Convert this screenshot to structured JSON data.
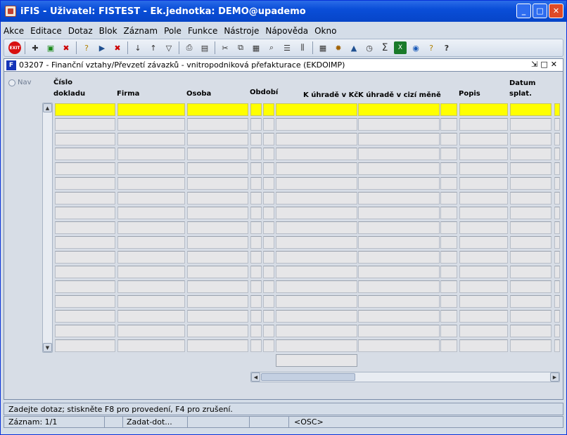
{
  "window": {
    "title": "iFIS - Uživatel: FISTEST - Ek.jednotka: DEMO@upademo"
  },
  "menu": [
    "Akce",
    "Editace",
    "Dotaz",
    "Blok",
    "Záznam",
    "Pole",
    "Funkce",
    "Nástroje",
    "Nápověda",
    "Okno"
  ],
  "toolbar_icons": [
    "exit-icon",
    "insert-record-icon",
    "save-icon",
    "clear-record-icon",
    "query-enter-icon",
    "query-execute-icon",
    "query-cancel-icon",
    "sort-asc-icon",
    "sort-desc-icon",
    "filter-icon",
    "print-icon",
    "print-preview-icon",
    "cut-icon",
    "copy-icon",
    "paste-icon",
    "find-icon",
    "list-icon",
    "columns-icon",
    "calculator-icon",
    "settings-icon",
    "tree-icon",
    "clock-icon",
    "sum-icon",
    "excel-icon",
    "web-icon",
    "key-help-icon",
    "help-icon"
  ],
  "form": {
    "title": "03207 - Finanční vztahy/Převzetí závazků - vnitropodniková přefakturace (EKDOIMP)",
    "nav_label": "Nav",
    "columns": [
      {
        "line1": "Číslo",
        "line2": "dokladu"
      },
      {
        "line1": "",
        "line2": "Firma"
      },
      {
        "line1": "",
        "line2": "Osoba"
      },
      {
        "line1": "Období",
        "line2": ""
      },
      {
        "line1": "K úhradě v Kč",
        "line2": ""
      },
      {
        "line1": "K úhradě v cizí měně",
        "line2": ""
      },
      {
        "line1": "",
        "line2": "Popis"
      },
      {
        "line1": "Datum",
        "line2": "splat."
      }
    ]
  },
  "status": {
    "message": "Zadejte dotaz; stiskněte F8 pro provedení, F4 pro zrušení.",
    "record": "Záznam: 1/1",
    "mode": "Zadat-dot...",
    "osc": "<OSC>"
  }
}
